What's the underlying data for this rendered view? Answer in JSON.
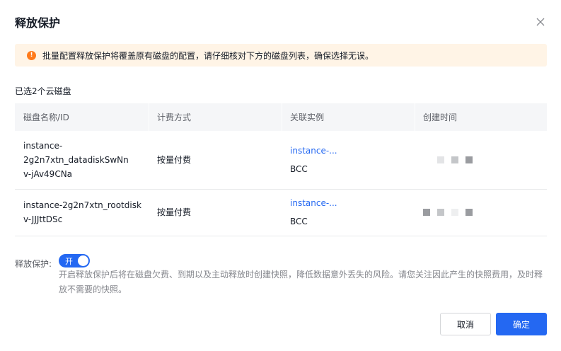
{
  "dialog": {
    "title": "释放保护",
    "alert_text": "批量配置释放保护将覆盖原有磁盘的配置，请仔细核对下方的磁盘列表，确保选择无误。",
    "selected_count_text": "已选2个云磁盘"
  },
  "table": {
    "headers": [
      "磁盘名称/ID",
      "计费方式",
      "关联实例",
      "创建时间"
    ],
    "rows": [
      {
        "name_lines": [
          "instance-",
          "2g2n7xtn_datadiskSwNn",
          "v-jAv49CNa"
        ],
        "billing": "按量付费",
        "instance_link": "instance-...",
        "instance_type": "BCC",
        "created_placeholder": [
          "#e3e4e6",
          "#c4c6c9",
          "#9a9ca0"
        ]
      },
      {
        "name_lines": [
          "instance-2g2n7xtn_rootdisk",
          "v-JJJttDSc"
        ],
        "billing": "按量付费",
        "instance_link": "instance-...",
        "instance_type": "BCC",
        "created_placeholder": [
          "#9a9ca0",
          "#c4c6c9",
          "#eeeff0",
          "#9a9ca0"
        ]
      }
    ]
  },
  "protection": {
    "label": "释放保护:",
    "switch_text": "开",
    "switch_on": true,
    "description": "开启释放保护后将在磁盘欠费、到期以及主动释放时创建快照，降低数据意外丢失的风险。请您关注因此产生的快照费用，及时释放不需要的快照。"
  },
  "footer": {
    "cancel_label": "取消",
    "ok_label": "确定"
  },
  "colors": {
    "primary": "#2468f2",
    "warning": "#ff7a1a",
    "alert_bg": "#fff4e6"
  },
  "icons": {
    "close": "close-icon",
    "warning": "warning-icon"
  }
}
